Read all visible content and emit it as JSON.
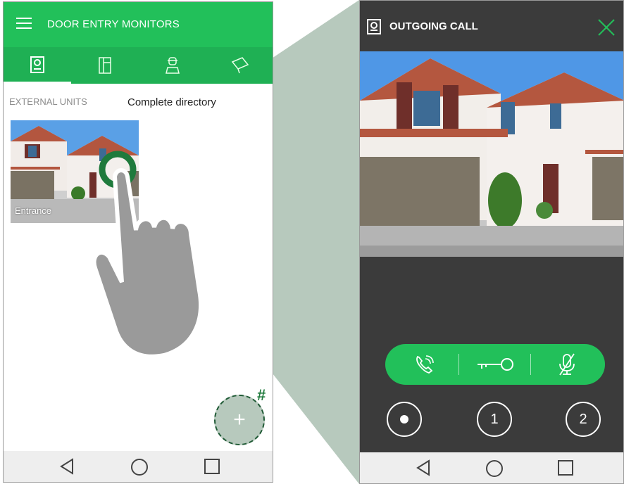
{
  "left_app": {
    "title": "DOOR ENTRY MONITORS",
    "tabs": [
      "monitor-icon",
      "intercom-handset-icon",
      "concierge-icon",
      "camera-icon"
    ],
    "section_label": "EXTERNAL UNITS",
    "section_link": "Complete directory",
    "unit_tile": {
      "label": "Entrance"
    },
    "fab_badge": "#",
    "fab_icon": "+"
  },
  "right_app": {
    "title": "OUTGOING CALL",
    "actions": [
      "call-end-icon",
      "door-key-icon",
      "mic-mute-icon"
    ],
    "buttons": [
      "1",
      "2"
    ],
    "record_icon": "record-dot-icon"
  },
  "nav": {
    "icons": [
      "back-icon",
      "home-icon",
      "recents-icon"
    ]
  },
  "colors": {
    "accent": "#22c05a",
    "accent_dark": "#1fb054",
    "highlight_ring": "#1f7a3c",
    "right_bg": "#3b3b3b",
    "callout": "#b7c9bd"
  }
}
